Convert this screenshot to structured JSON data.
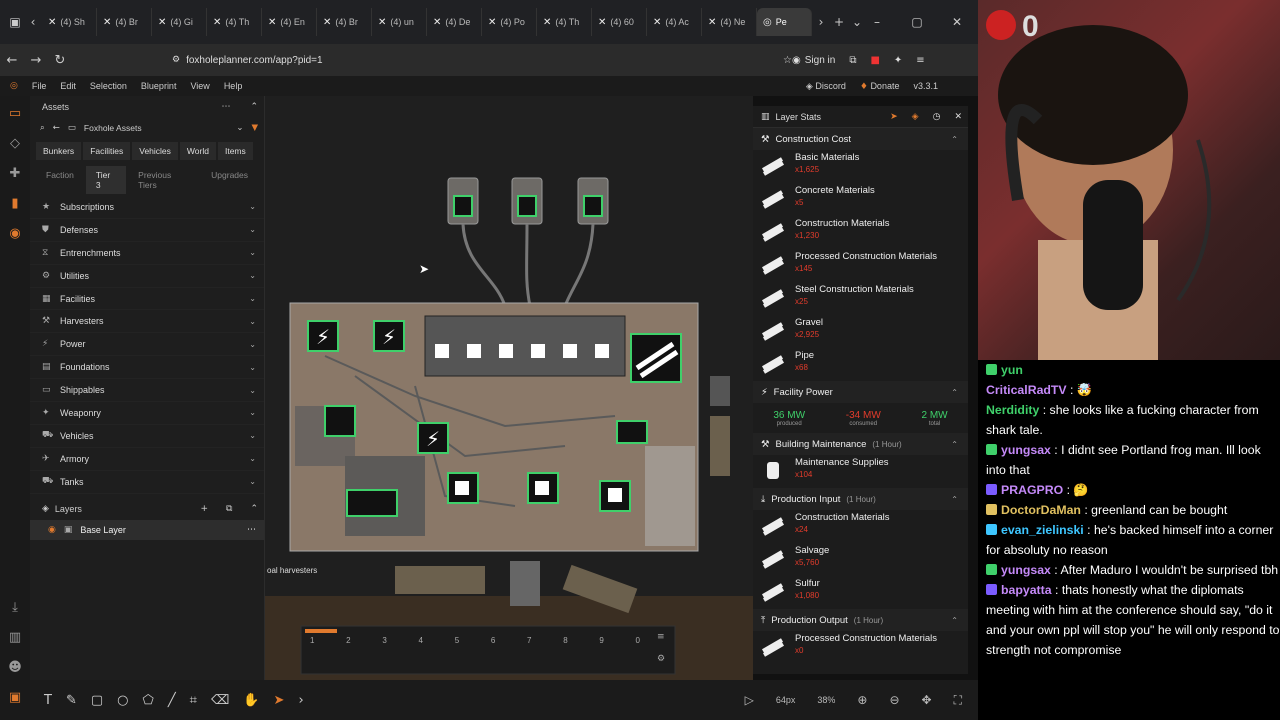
{
  "browser": {
    "tabs": [
      "(4) Sh",
      "(4) Br",
      "(4) Gi",
      "(4) Th",
      "(4) En",
      "(4) Br",
      "(4) un",
      "(4) De",
      "(4) Po",
      "(4) Th",
      "(4) 60",
      "(4) Ac",
      "(4) Ne",
      "Pe"
    ],
    "url": "foxholeplanner.com/app?pid=1",
    "sign_in": "Sign in"
  },
  "app": {
    "menu": [
      "File",
      "Edit",
      "Selection",
      "Blueprint",
      "View",
      "Help"
    ],
    "discord": "Discord",
    "donate": "Donate",
    "version": "v3.3.1"
  },
  "assets": {
    "title": "Assets",
    "folder": "Foxhole Assets",
    "tabs": [
      "Bunkers",
      "Facilities",
      "Vehicles",
      "World",
      "Items"
    ],
    "tabs2": [
      "Faction",
      "Tier 3",
      "Previous Tiers",
      "Upgrades"
    ],
    "categories": [
      "Subscriptions",
      "Defenses",
      "Entrenchments",
      "Utilities",
      "Facilities",
      "Harvesters",
      "Power",
      "Foundations",
      "Shippables",
      "Weaponry",
      "Vehicles",
      "Armory",
      "Tanks"
    ],
    "layers_title": "Layers",
    "base_layer": "Base Layer"
  },
  "canvas": {
    "label": "oal harvesters",
    "hotbar": [
      "1",
      "2",
      "3",
      "4",
      "5",
      "6",
      "7",
      "8",
      "9",
      "0"
    ]
  },
  "bottom": {
    "zoom_px": "64px",
    "zoom_pct": "38%"
  },
  "stats": {
    "title": "Layer Stats",
    "construction_cost": "Construction Cost",
    "materials": [
      {
        "name": "Basic Materials",
        "qty": "x1,625"
      },
      {
        "name": "Concrete Materials",
        "qty": "x5"
      },
      {
        "name": "Construction Materials",
        "qty": "x1,230"
      },
      {
        "name": "Processed Construction Materials",
        "qty": "x145"
      },
      {
        "name": "Steel Construction Materials",
        "qty": "x25"
      },
      {
        "name": "Gravel",
        "qty": "x2,925"
      },
      {
        "name": "Pipe",
        "qty": "x68"
      }
    ],
    "facility_power": "Facility Power",
    "power": [
      {
        "value": "36 MW",
        "label": "produced",
        "color": "#3fd06a"
      },
      {
        "value": "-34 MW",
        "label": "consumed",
        "color": "#e23c2c"
      },
      {
        "value": "2 MW",
        "label": "total",
        "color": "#3fd06a"
      }
    ],
    "maintenance": "Building Maintenance",
    "maintenance_sub": "(1 Hour)",
    "maintenance_item": {
      "name": "Maintenance Supplies",
      "qty": "x104"
    },
    "input": "Production Input",
    "input_sub": "(1 Hour)",
    "input_items": [
      {
        "name": "Construction Materials",
        "qty": "x24"
      },
      {
        "name": "Salvage",
        "qty": "x5,760"
      },
      {
        "name": "Sulfur",
        "qty": "x1,080"
      }
    ],
    "output": "Production Output",
    "output_sub": "(1 Hour)",
    "output_items": [
      {
        "name": "Processed Construction Materials",
        "qty": "x0"
      }
    ]
  },
  "overlay_num": "0",
  "chat": [
    {
      "user": "yun",
      "color": "#3fd06a",
      "text": "",
      "badge": "#3fd06a"
    },
    {
      "user": "CriticalRadTV",
      "color": "#c58af9",
      "text": " : 🤯",
      "badge": ""
    },
    {
      "user": "Nerdidity",
      "color": "#3fd06a",
      "text": " : she looks like a fucking character from shark tale.",
      "badge": ""
    },
    {
      "user": "yungsax",
      "color": "#c58af9",
      "text": " : I didnt see Portland frog man. Ill look into that",
      "badge": "#3fd06a"
    },
    {
      "user": "PRAGPRO",
      "color": "#c58af9",
      "text": " : 🤔",
      "badge": "#7b5cff"
    },
    {
      "user": "DoctorDaMan",
      "color": "#e0c060",
      "text": " : greenland can be bought",
      "badge": "#e0c060"
    },
    {
      "user": "evan_zielinski",
      "color": "#3ec6ff",
      "text": " : he's backed himself into a corner for absoluty no reason",
      "badge": "#3ec6ff"
    },
    {
      "user": "yungsax",
      "color": "#c58af9",
      "text": " : After Maduro I wouldn't be surprised tbh",
      "badge": "#3fd06a"
    },
    {
      "user": "bapyatta",
      "color": "#c58af9",
      "text": " : thats honestly what the diplomats meeting with him at the conference should say, \"do it and your own ppl will stop you\" he will only respond to strength not compromise",
      "badge": "#7b5cff"
    }
  ]
}
